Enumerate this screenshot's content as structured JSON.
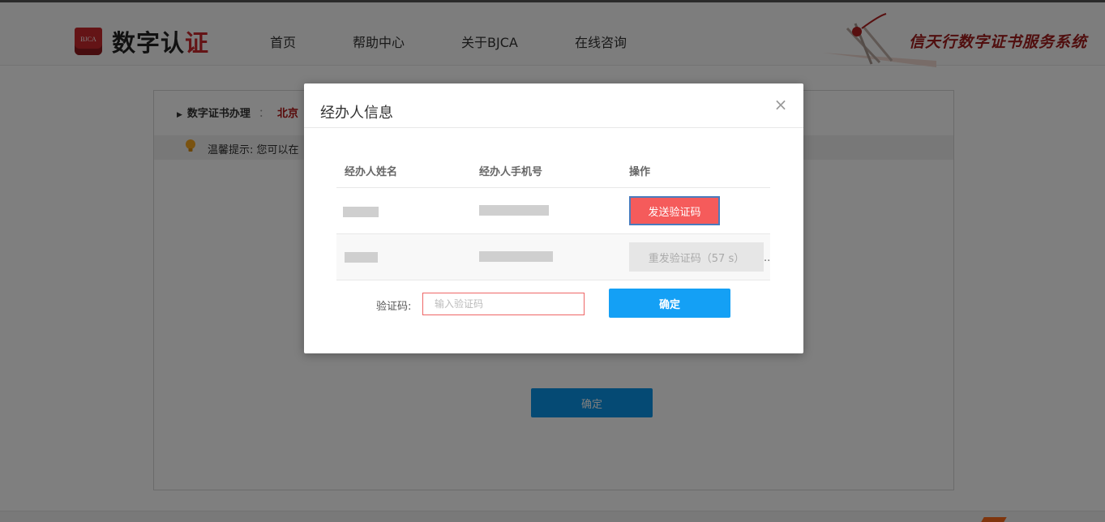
{
  "header": {
    "logo_badge": "BJCA",
    "logo_text_main": "数字认",
    "logo_text_accent": "证",
    "nav": [
      "首页",
      "帮助中心",
      "关于BJCA",
      "在线咨询"
    ],
    "brand_slogan": "信天行数字证书服务系统"
  },
  "page": {
    "breadcrumb_label": "数字证书办理",
    "breadcrumb_sep": "：",
    "breadcrumb_value": "北京",
    "tip_text": "温馨提示:  您可以在",
    "confirm_label": "确定"
  },
  "modal": {
    "title": "经办人信息",
    "close_glyph": "×",
    "columns": [
      "经办人姓名",
      "经办人手机号",
      "操作"
    ],
    "rows": [
      {
        "action_label": "发送验证码"
      },
      {
        "action_label": "重发验证码（57 s）",
        "trailing": ".."
      }
    ],
    "code_label": "验证码:",
    "code_placeholder": "输入验证码",
    "confirm_label": "确定"
  },
  "colors": {
    "send_button": "#f55b5b",
    "confirm_button": "#14a0f5",
    "brand_red": "#c8282d"
  }
}
